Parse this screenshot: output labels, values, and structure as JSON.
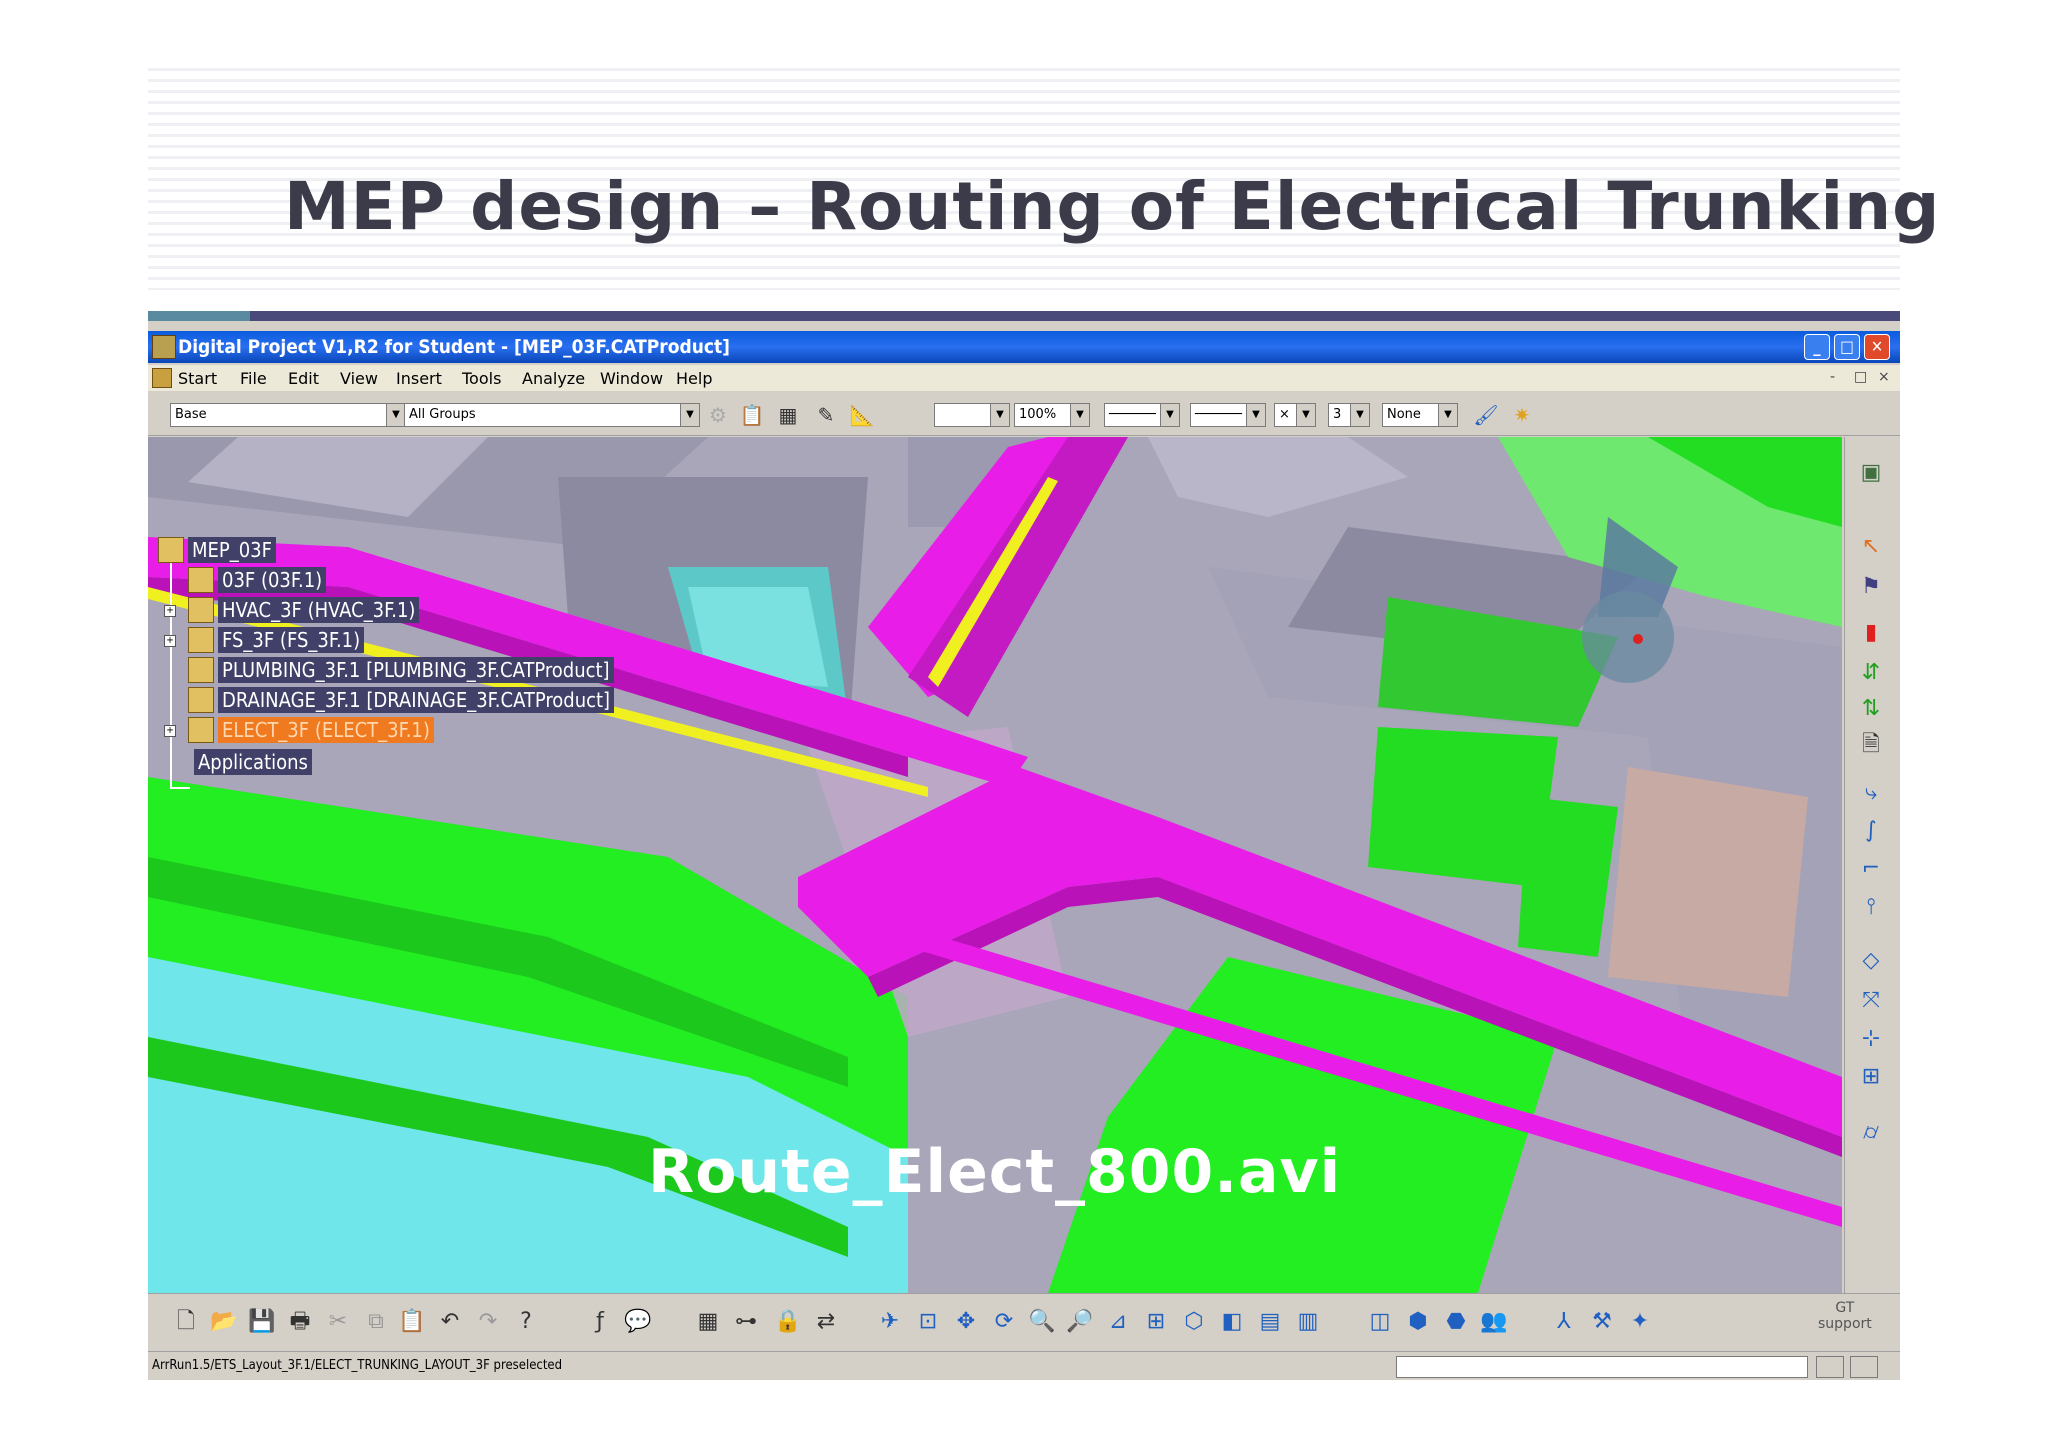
{
  "slide": {
    "title": "MEP design – Routing of Electrical Trunking"
  },
  "window": {
    "title": "Digital Project V1,R2 for Student - [MEP_03F.CATProduct]",
    "controls": {
      "minimize": "_",
      "maximize": "□",
      "close": "✕"
    }
  },
  "menu": {
    "items": [
      "Start",
      "File",
      "Edit",
      "View",
      "Insert",
      "Tools",
      "Analyze",
      "Window",
      "Help"
    ],
    "mdi_controls": [
      "-",
      "□",
      "×"
    ]
  },
  "toolbar": {
    "layer_combo": "Base",
    "group_combo": "All Groups",
    "zoom_combo": "100%",
    "weight_combo": "3",
    "color_combo": "None",
    "icons": [
      "settings-icon",
      "paste-icon",
      "catalog-icon",
      "measure-icon",
      "ruler-icon",
      "paint-icon",
      "sun-icon"
    ]
  },
  "tree": {
    "nodes": [
      {
        "label": "MEP_03F",
        "selected": false,
        "expandable": false
      },
      {
        "label": "03F (03F.1)",
        "selected": false,
        "expandable": false
      },
      {
        "label": "HVAC_3F (HVAC_3F.1)",
        "selected": false,
        "expandable": true
      },
      {
        "label": "FS_3F (FS_3F.1)",
        "selected": false,
        "expandable": true
      },
      {
        "label": "PLUMBING_3F.1 [PLUMBING_3F.CATProduct]",
        "selected": false,
        "expandable": false
      },
      {
        "label": "DRAINAGE_3F.1 [DRAINAGE_3F.CATProduct]",
        "selected": false,
        "expandable": false
      },
      {
        "label": "ELECT_3F (ELECT_3F.1)",
        "selected": true,
        "expandable": true
      }
    ],
    "applications_label": "Applications"
  },
  "viewport": {
    "overlay_text": "Route_Elect_800.avi",
    "colors": {
      "trunking": "#e81ee8",
      "floor": "#22ee22",
      "walls": "#a8a6b8",
      "water": "#6ee6ea",
      "yellow_line": "#f0f020"
    }
  },
  "right_toolbar": {
    "icons": [
      "wireframe-icon",
      "select-arrow-icon",
      "run-icon",
      "chart-icon",
      "route-icon",
      "route-alt-icon",
      "document-icon",
      "spline-icon",
      "curve-icon",
      "bend-icon",
      "branch-icon",
      "diamond-icon",
      "offset-icon",
      "node-icon",
      "grid-icon",
      "cylinder-icon"
    ]
  },
  "bottom_toolbar": {
    "icons": [
      "new-icon",
      "open-icon",
      "save-icon",
      "print-icon",
      "cut-icon",
      "copy-icon",
      "paste-icon",
      "undo-icon",
      "redo-icon",
      "help-icon",
      "formula-icon",
      "comment-icon",
      "table-icon",
      "tree-icon",
      "lock-icon",
      "swap-icon",
      "fly-icon",
      "fit-all-icon",
      "pan-icon",
      "rotate-icon",
      "zoom-in-icon",
      "zoom-out-icon",
      "normal-view-icon",
      "multi-view-icon",
      "iso-view-icon",
      "shading-icon",
      "hide-icon",
      "swap-space-icon",
      "box-icon",
      "cube-icon",
      "cube-alt-icon",
      "people-icon",
      "axis-icon",
      "tool-icon",
      "compass-icon"
    ],
    "gt_support_label": "GT\nsupport"
  },
  "status": {
    "text": "ArrRun1.5/ETS_Layout_3F.1/ELECT_TRUNKING_LAYOUT_3F preselected"
  }
}
